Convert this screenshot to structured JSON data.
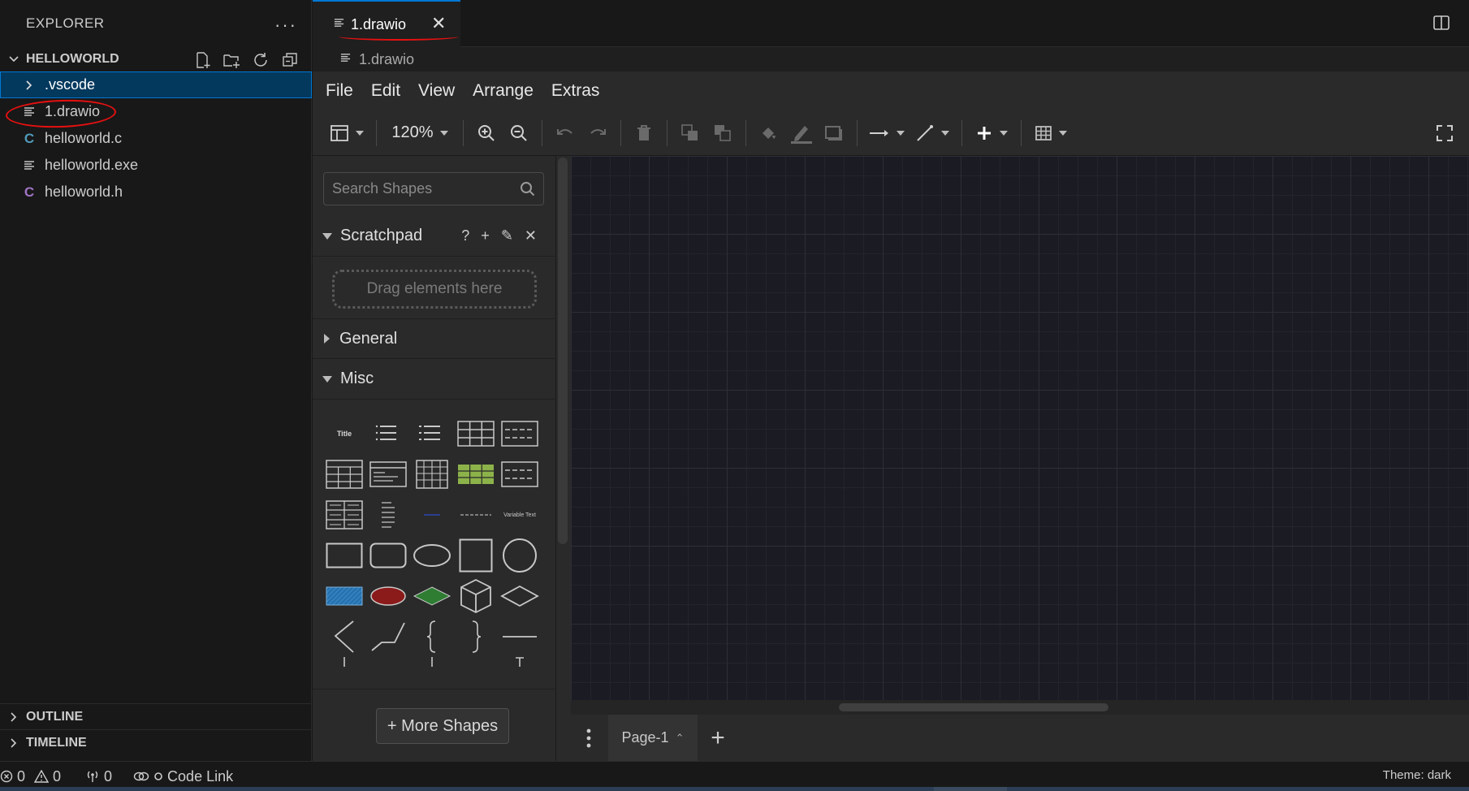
{
  "sidebar": {
    "title": "EXPLORER",
    "more_label": "···",
    "folder": "HELLOWORLD",
    "items": [
      {
        "label": ".vscode",
        "kind": "folder"
      },
      {
        "label": "1.drawio",
        "kind": "text"
      },
      {
        "label": "helloworld.c",
        "kind": "c"
      },
      {
        "label": "helloworld.exe",
        "kind": "text"
      },
      {
        "label": "helloworld.h",
        "kind": "h"
      }
    ],
    "c_glyph": "C",
    "sections": [
      "OUTLINE",
      "TIMELINE"
    ]
  },
  "editor": {
    "tab_label": "1.drawio",
    "tab_close": "✕",
    "breadcrumb": "1.drawio"
  },
  "drawio": {
    "menu": [
      "File",
      "Edit",
      "View",
      "Arrange",
      "Extras"
    ],
    "zoom": "120%",
    "search_placeholder": "Search Shapes",
    "scratchpad": {
      "title": "Scratchpad",
      "help": "?",
      "add": "+",
      "edit": "✎",
      "close": "✕",
      "drop_hint": "Drag elements here"
    },
    "general_label": "General",
    "misc_label": "Misc",
    "misc_shape_texts": {
      "title": "Title",
      "variable": "Variable Text"
    },
    "more_shapes": "+ More Shapes",
    "page_tab": "Page-1",
    "page_tab_caret": "⌃",
    "add_page": "+"
  },
  "statusbar": {
    "errors": "0",
    "warnings": "0",
    "ports": "0",
    "code_link": "Code Link",
    "theme": "Theme: dark"
  },
  "colors": {
    "accent": "#0078d4",
    "selection": "#04395e",
    "annotation": "#e81010",
    "shape_blue": "#2f7fbf",
    "shape_red": "#8b1a1a",
    "shape_green": "#2e7d32",
    "shape_table_green": "#8cb24a"
  }
}
